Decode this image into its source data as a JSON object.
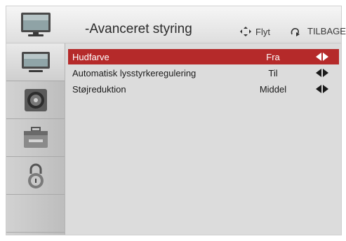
{
  "header": {
    "title": "-Avanceret styring",
    "move_label": "Flyt",
    "back_label": "TILBAGE"
  },
  "sidebar": {
    "items": [
      {
        "icon": "picture-icon",
        "active": true
      },
      {
        "icon": "speaker-icon",
        "active": false
      },
      {
        "icon": "toolbox-icon",
        "active": false
      },
      {
        "icon": "lock-icon",
        "active": false
      },
      {
        "icon": "",
        "active": false
      }
    ]
  },
  "menu": {
    "rows": [
      {
        "label": "Hudfarve",
        "value": "Fra",
        "selected": true
      },
      {
        "label": "Automatisk lysstyrkeregulering",
        "value": "Til",
        "selected": false
      },
      {
        "label": "Støjreduktion",
        "value": "Middel",
        "selected": false
      }
    ]
  },
  "colors": {
    "selected_row": "#b52a2a",
    "background": "#dcdcdc"
  }
}
